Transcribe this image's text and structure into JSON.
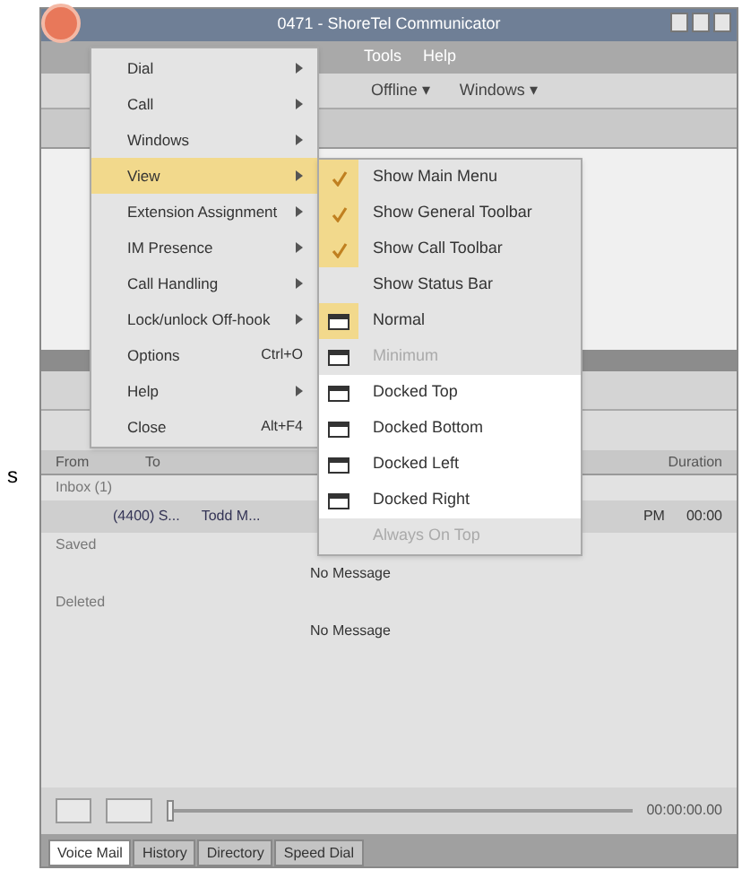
{
  "stray_text": "s",
  "window": {
    "title": "0471 - ShoreTel Communicator"
  },
  "menubar": [
    "Tools",
    "Help"
  ],
  "toolbar": [
    {
      "label": "Offline ▾"
    },
    {
      "label": "Windows ▾"
    }
  ],
  "main_menu": [
    {
      "label": "Dial",
      "submenu": true,
      "selected": false
    },
    {
      "label": "Call",
      "submenu": true,
      "selected": false
    },
    {
      "label": "Windows",
      "submenu": true,
      "selected": false
    },
    {
      "label": "View",
      "submenu": true,
      "selected": true
    },
    {
      "label": "Extension Assignment",
      "submenu": true,
      "selected": false
    },
    {
      "label": "IM Presence",
      "submenu": true,
      "selected": false
    },
    {
      "label": "Call Handling",
      "submenu": true,
      "selected": false
    },
    {
      "label": "Lock/unlock Off-hook",
      "submenu": true,
      "selected": false
    },
    {
      "label": "Options",
      "shortcut": "Ctrl+O",
      "submenu": false,
      "selected": false
    },
    {
      "label": "Help",
      "submenu": true,
      "selected": false
    },
    {
      "label": "Close",
      "shortcut": "Alt+F4",
      "submenu": false,
      "selected": false
    }
  ],
  "view_submenu": [
    {
      "kind": "check",
      "label": "Show Main Menu",
      "checked": true,
      "disabled": false
    },
    {
      "kind": "check",
      "label": "Show General Toolbar",
      "checked": true,
      "disabled": false
    },
    {
      "kind": "check",
      "label": "Show Call Toolbar",
      "checked": true,
      "disabled": false
    },
    {
      "kind": "check",
      "label": "Show Status Bar",
      "checked": false,
      "disabled": false
    },
    {
      "kind": "mode",
      "label": "Normal",
      "selected": true,
      "disabled": false
    },
    {
      "kind": "mode",
      "label": "Minimum",
      "selected": false,
      "disabled": true
    },
    {
      "kind": "mode",
      "label": "Docked Top",
      "selected": false,
      "disabled": false
    },
    {
      "kind": "mode",
      "label": "Docked Bottom",
      "selected": false,
      "disabled": false
    },
    {
      "kind": "mode",
      "label": "Docked Left",
      "selected": false,
      "disabled": false
    },
    {
      "kind": "mode",
      "label": "Docked Right",
      "selected": false,
      "disabled": false
    },
    {
      "kind": "check",
      "label": "Always On Top",
      "checked": false,
      "disabled": true
    }
  ],
  "voicemail": {
    "columns": [
      "From",
      "To",
      "Duration"
    ],
    "groups": [
      {
        "name": "Inbox (1)",
        "rows": [
          {
            "from": "(4400) S...",
            "to": "Todd M...",
            "time": "PM",
            "duration": "00:00"
          }
        ]
      },
      {
        "name": "Saved",
        "empty": "No Message"
      },
      {
        "name": "Deleted",
        "empty": "No Message"
      }
    ],
    "position": "00:00:00.00",
    "seek": {
      "level": 0
    }
  },
  "tabs": [
    {
      "label": "Voice Mail",
      "selected": true
    },
    {
      "label": "History",
      "selected": false
    },
    {
      "label": "Directory",
      "selected": false
    },
    {
      "label": "Speed Dial",
      "selected": false
    }
  ]
}
